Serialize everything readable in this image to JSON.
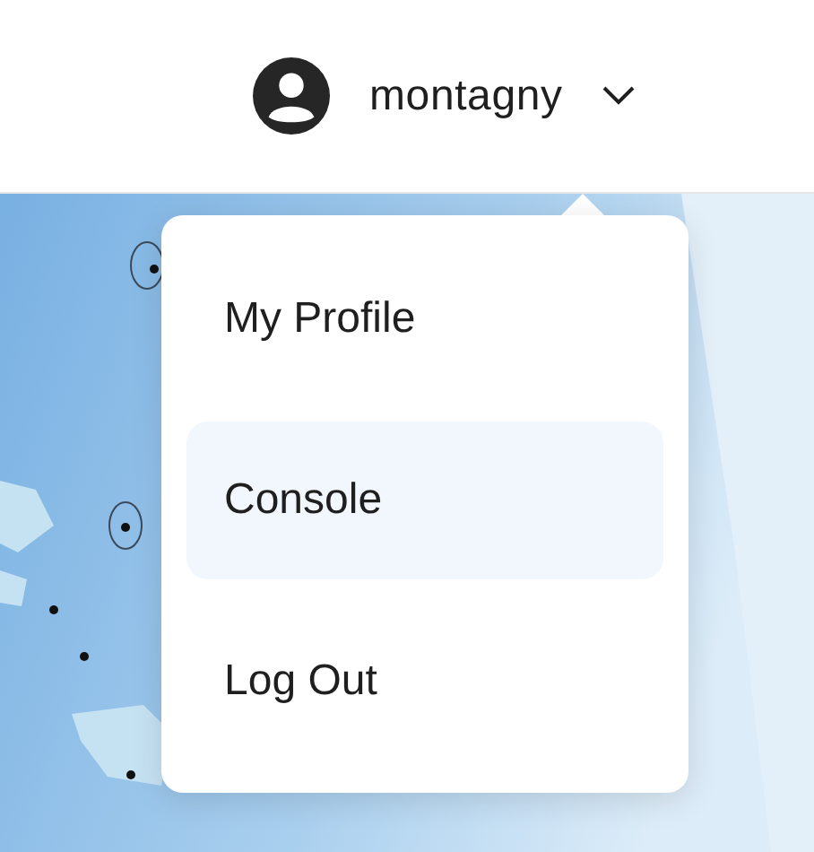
{
  "header": {
    "username": "montagny",
    "menu_open": true
  },
  "menu": {
    "items": [
      {
        "label": "My Profile",
        "selected": false
      },
      {
        "label": "Console",
        "selected": true
      },
      {
        "label": "Log Out",
        "selected": false
      }
    ]
  }
}
